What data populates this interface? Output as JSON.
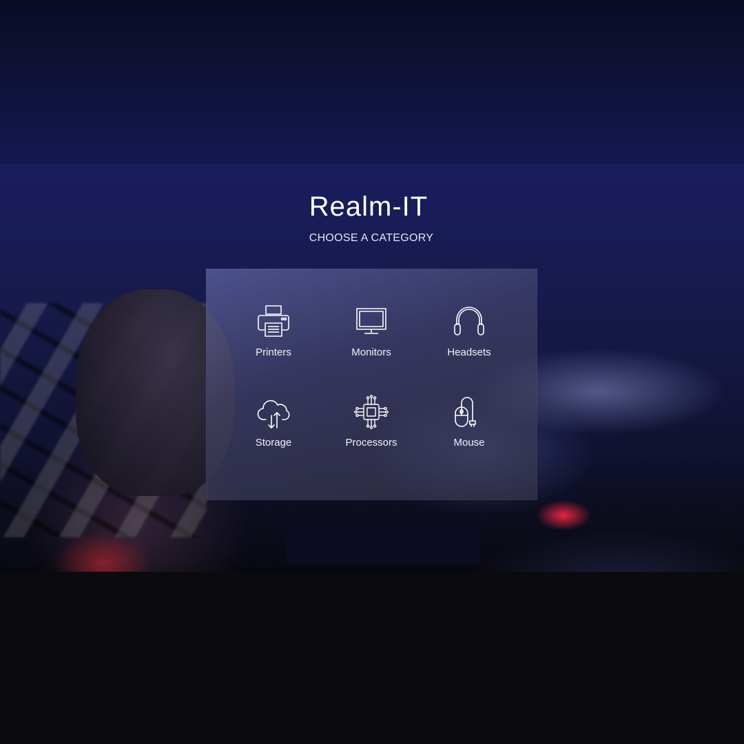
{
  "app": {
    "title": "Realm-IT",
    "subtitle": "CHOOSE A CATEGORY"
  },
  "categories": [
    {
      "label": "Printers",
      "icon": "printer-icon"
    },
    {
      "label": "Monitors",
      "icon": "monitor-icon"
    },
    {
      "label": "Headsets",
      "icon": "headset-icon"
    },
    {
      "label": "Storage",
      "icon": "cloud-storage-icon"
    },
    {
      "label": "Processors",
      "icon": "processor-chip-icon"
    },
    {
      "label": "Mouse",
      "icon": "mouse-icon"
    }
  ],
  "colors": {
    "text": "#ffffff",
    "panel": "#5a5a80"
  }
}
